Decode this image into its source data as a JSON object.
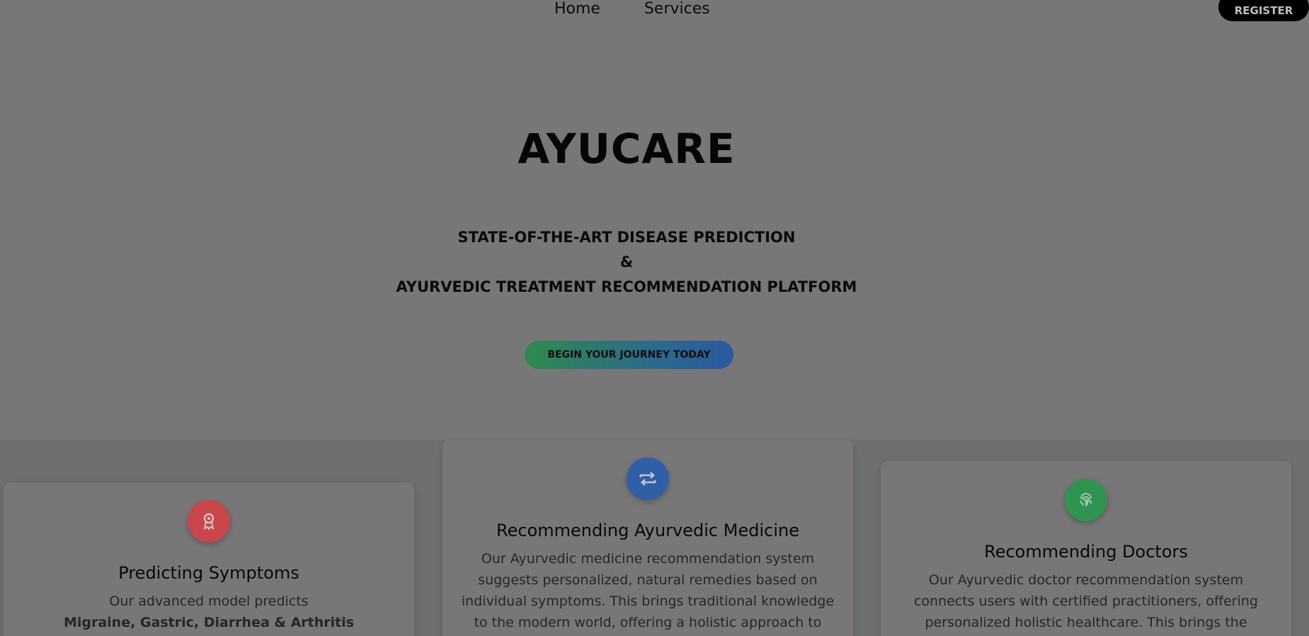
{
  "nav": {
    "links": [
      "Home",
      "Services"
    ],
    "register_label": "REGISTER"
  },
  "hero": {
    "title": "AYUCARE",
    "subtitle_lines": [
      "STATE-OF-THE-ART DISEASE PREDICTION",
      "&",
      "AYURVEDIC TREATMENT RECOMMENDATION PLATFORM"
    ],
    "cta_label": "BEGIN YOUR JOURNEY TODAY"
  },
  "cards": [
    {
      "icon": "award-icon",
      "icon_color": "#c9474a",
      "title": "Predicting Symptoms",
      "text": "Our advanced model predicts",
      "text_bold": "Migraine, Gastric, Diarrhea & Arthritis"
    },
    {
      "icon": "repeat-icon",
      "icon_color": "#2f5fa6",
      "title": "Recommending Ayurvedic Medicine",
      "text": "Our Ayurvedic medicine recommendation system suggests personalized, natural remedies based on individual symptoms. This brings traditional knowledge to the modern world, offering a holistic approach to health that promotes"
    },
    {
      "icon": "fingerprint-icon",
      "icon_color": "#2e9450",
      "title": "Recommending Doctors",
      "text": "Our Ayurvedic doctor recommendation system connects users with certified practitioners, offering personalized holistic healthcare. This brings the ancient practice of"
    }
  ],
  "colors": {
    "background": "#777777",
    "lower_band": "#6e6f70",
    "register_bg": "#000000",
    "cta_gradient_start": "#2e8b4e",
    "cta_gradient_end": "#2a5aa0"
  }
}
